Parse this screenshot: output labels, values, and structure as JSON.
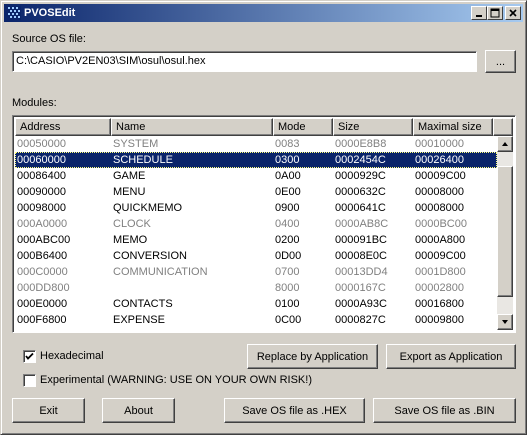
{
  "window": {
    "title": "PVOSEdit"
  },
  "source": {
    "label": "Source OS file:",
    "path": "C:\\CASIO\\PV2EN03\\SIM\\osul\\osul.hex",
    "browse_label": "..."
  },
  "modules": {
    "label": "Modules:",
    "columns": [
      "Address",
      "Name",
      "Mode",
      "Size",
      "Maximal size"
    ],
    "rows": [
      {
        "address": "00050000",
        "name": "SYSTEM",
        "mode": "0083",
        "size": "0000E8B8",
        "max": "00010000",
        "state": "dim"
      },
      {
        "address": "00060000",
        "name": "SCHEDULE",
        "mode": "0300",
        "size": "0002454C",
        "max": "00026400",
        "state": "selected"
      },
      {
        "address": "00086400",
        "name": "GAME",
        "mode": "0A00",
        "size": "0000929C",
        "max": "00009C00",
        "state": "normal"
      },
      {
        "address": "00090000",
        "name": "MENU",
        "mode": "0E00",
        "size": "0000632C",
        "max": "00008000",
        "state": "normal"
      },
      {
        "address": "00098000",
        "name": "QUICKMEMO",
        "mode": "0900",
        "size": "0000641C",
        "max": "00008000",
        "state": "normal"
      },
      {
        "address": "000A0000",
        "name": "CLOCK",
        "mode": "0400",
        "size": "0000AB8C",
        "max": "0000BC00",
        "state": "dim"
      },
      {
        "address": "000ABC00",
        "name": "MEMO",
        "mode": "0200",
        "size": "000091BC",
        "max": "0000A800",
        "state": "normal"
      },
      {
        "address": "000B6400",
        "name": "CONVERSION",
        "mode": "0D00",
        "size": "00008E0C",
        "max": "00009C00",
        "state": "normal"
      },
      {
        "address": "000C0000",
        "name": "COMMUNICATION",
        "mode": "0700",
        "size": "00013DD4",
        "max": "0001D800",
        "state": "dim"
      },
      {
        "address": "000DD800",
        "name": "",
        "mode": "8000",
        "size": "0000167C",
        "max": "00002800",
        "state": "dim"
      },
      {
        "address": "000E0000",
        "name": "CONTACTS",
        "mode": "0100",
        "size": "0000A93C",
        "max": "00016800",
        "state": "normal"
      },
      {
        "address": "000F6800",
        "name": "EXPENSE",
        "mode": "0C00",
        "size": "0000827C",
        "max": "00009800",
        "state": "normal"
      }
    ]
  },
  "options": {
    "hexadecimal": {
      "label": "Hexadecimal",
      "checked": true
    },
    "experimental": {
      "label": "Experimental (WARNING: USE ON YOUR OWN RISK!)",
      "checked": false
    }
  },
  "buttons": {
    "replace": "Replace by Application",
    "export": "Export as Application",
    "exit": "Exit",
    "about": "About",
    "save_hex": "Save OS file as .HEX",
    "save_bin": "Save OS file as .BIN"
  },
  "colors": {
    "title_start": "#0a246a",
    "title_end": "#a6caf0",
    "selection": "#0a246a",
    "dim_text": "#808080"
  }
}
